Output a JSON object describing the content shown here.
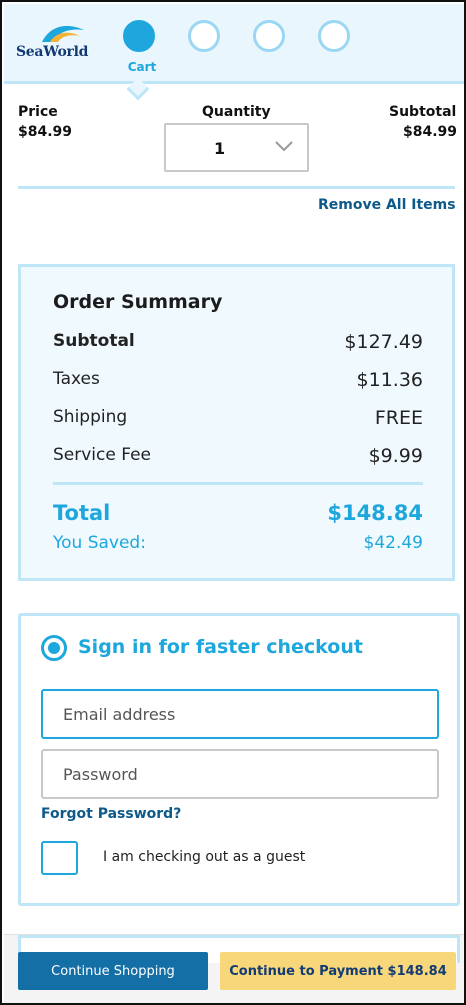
{
  "brand": {
    "logo_text": "SeaWorld"
  },
  "stepper": {
    "active_label": "Cart",
    "step_count": 4,
    "active_index": 0
  },
  "cart": {
    "price_label": "Price",
    "price_value": "$84.99",
    "quantity_label": "Quantity",
    "quantity_value": "1",
    "subtotal_label": "Subtotal",
    "subtotal_value": "$84.99",
    "remove_all_label": "Remove All Items"
  },
  "summary": {
    "title": "Order Summary",
    "rows": [
      {
        "label": "Subtotal",
        "value": "$127.49"
      },
      {
        "label": "Taxes",
        "value": "$11.36"
      },
      {
        "label": "Shipping",
        "value": "FREE"
      },
      {
        "label": "Service Fee",
        "value": "$9.99"
      }
    ],
    "total_label": "Total",
    "total_value": "$148.84",
    "saved_label": "You Saved:",
    "saved_value": "$42.49"
  },
  "signin": {
    "title": "Sign in for faster checkout",
    "email_placeholder": "Email address",
    "password_placeholder": "Password",
    "forgot_label": "Forgot Password?",
    "guest_label": "I am checking out as a guest"
  },
  "footer": {
    "continue_shopping_label": "Continue Shopping",
    "continue_payment_label": "Continue to Payment $148.84"
  },
  "colors": {
    "accent": "#1ea7dc",
    "link": "#0d5a8a",
    "primary_button": "#136fa6",
    "payment_button": "#f7d77a",
    "panel_border": "#bfe6f6"
  },
  "icons": {
    "quantity_dropdown": "chevron-down-icon",
    "logo": "seaworld-logo"
  }
}
